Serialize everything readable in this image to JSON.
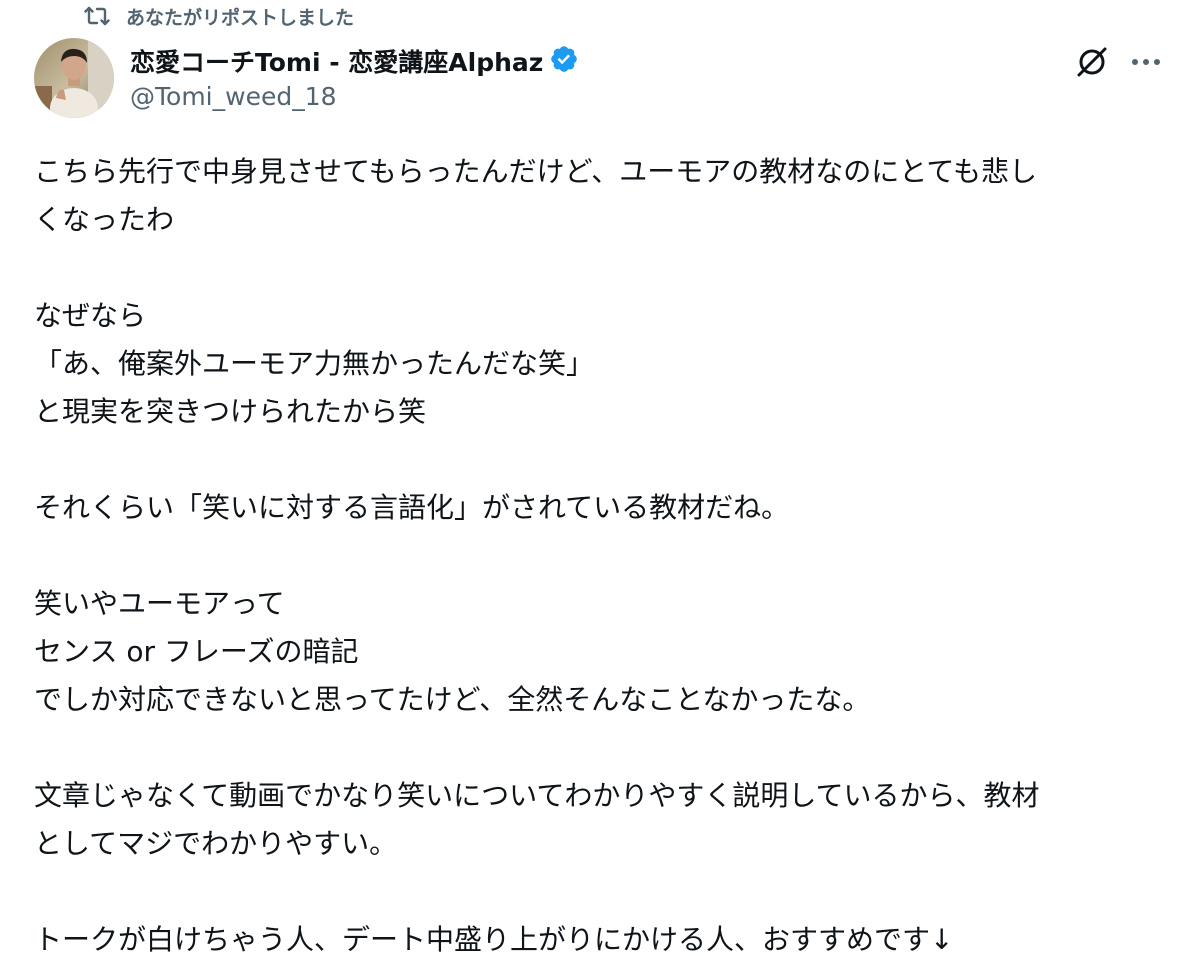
{
  "repost": {
    "label": "あなたがリポストしました",
    "icon": "repost-icon"
  },
  "author": {
    "display_name": "恋愛コーチTomi - 恋愛講座Alphaz",
    "handle": "@Tomi_weed_18",
    "verified": true,
    "verified_color": "#1d9bf0"
  },
  "actions": {
    "grok_icon": "grok-icon",
    "more_icon": "more-icon"
  },
  "post": {
    "lines": [
      "こちら先行で中身見させてもらったんだけど、ユーモアの教材なのにとても悲し",
      "くなったわ",
      "",
      "なぜなら",
      "「あ、俺案外ユーモア力無かったんだな笑」",
      "と現実を突きつけられたから笑",
      "",
      "それくらい「笑いに対する言語化」がされている教材だね。",
      "",
      "笑いやユーモアって",
      "センス or フレーズの暗記",
      "でしか対応できないと思ってたけど、全然そんなことなかったな。",
      "",
      "文章じゃなくて動画でかなり笑いについてわかりやすく説明しているから、教材",
      "としてマジでわかりやすい。",
      "",
      "トークが白けちゃう人、デート中盛り上がりにかける人、おすすめです↓"
    ]
  },
  "colors": {
    "text": "#0f1419",
    "secondary": "#536471",
    "accent": "#1d9bf0"
  }
}
